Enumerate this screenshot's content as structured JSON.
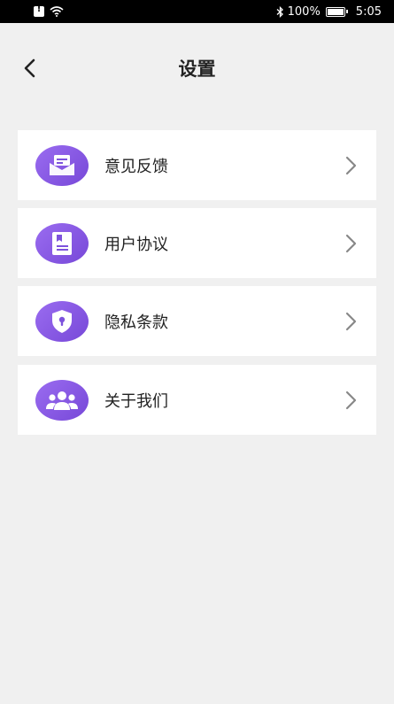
{
  "status_bar": {
    "battery_text": "100%",
    "time": "5:05"
  },
  "header": {
    "title": "设置"
  },
  "menu": {
    "items": [
      {
        "label": "意见反馈",
        "icon": "feedback-envelope-icon"
      },
      {
        "label": "用户协议",
        "icon": "agreement-document-icon"
      },
      {
        "label": "隐私条款",
        "icon": "privacy-shield-icon"
      },
      {
        "label": "关于我们",
        "icon": "about-us-group-icon"
      }
    ]
  },
  "colors": {
    "accent": "#8457e0",
    "background": "#f0f0f0"
  }
}
